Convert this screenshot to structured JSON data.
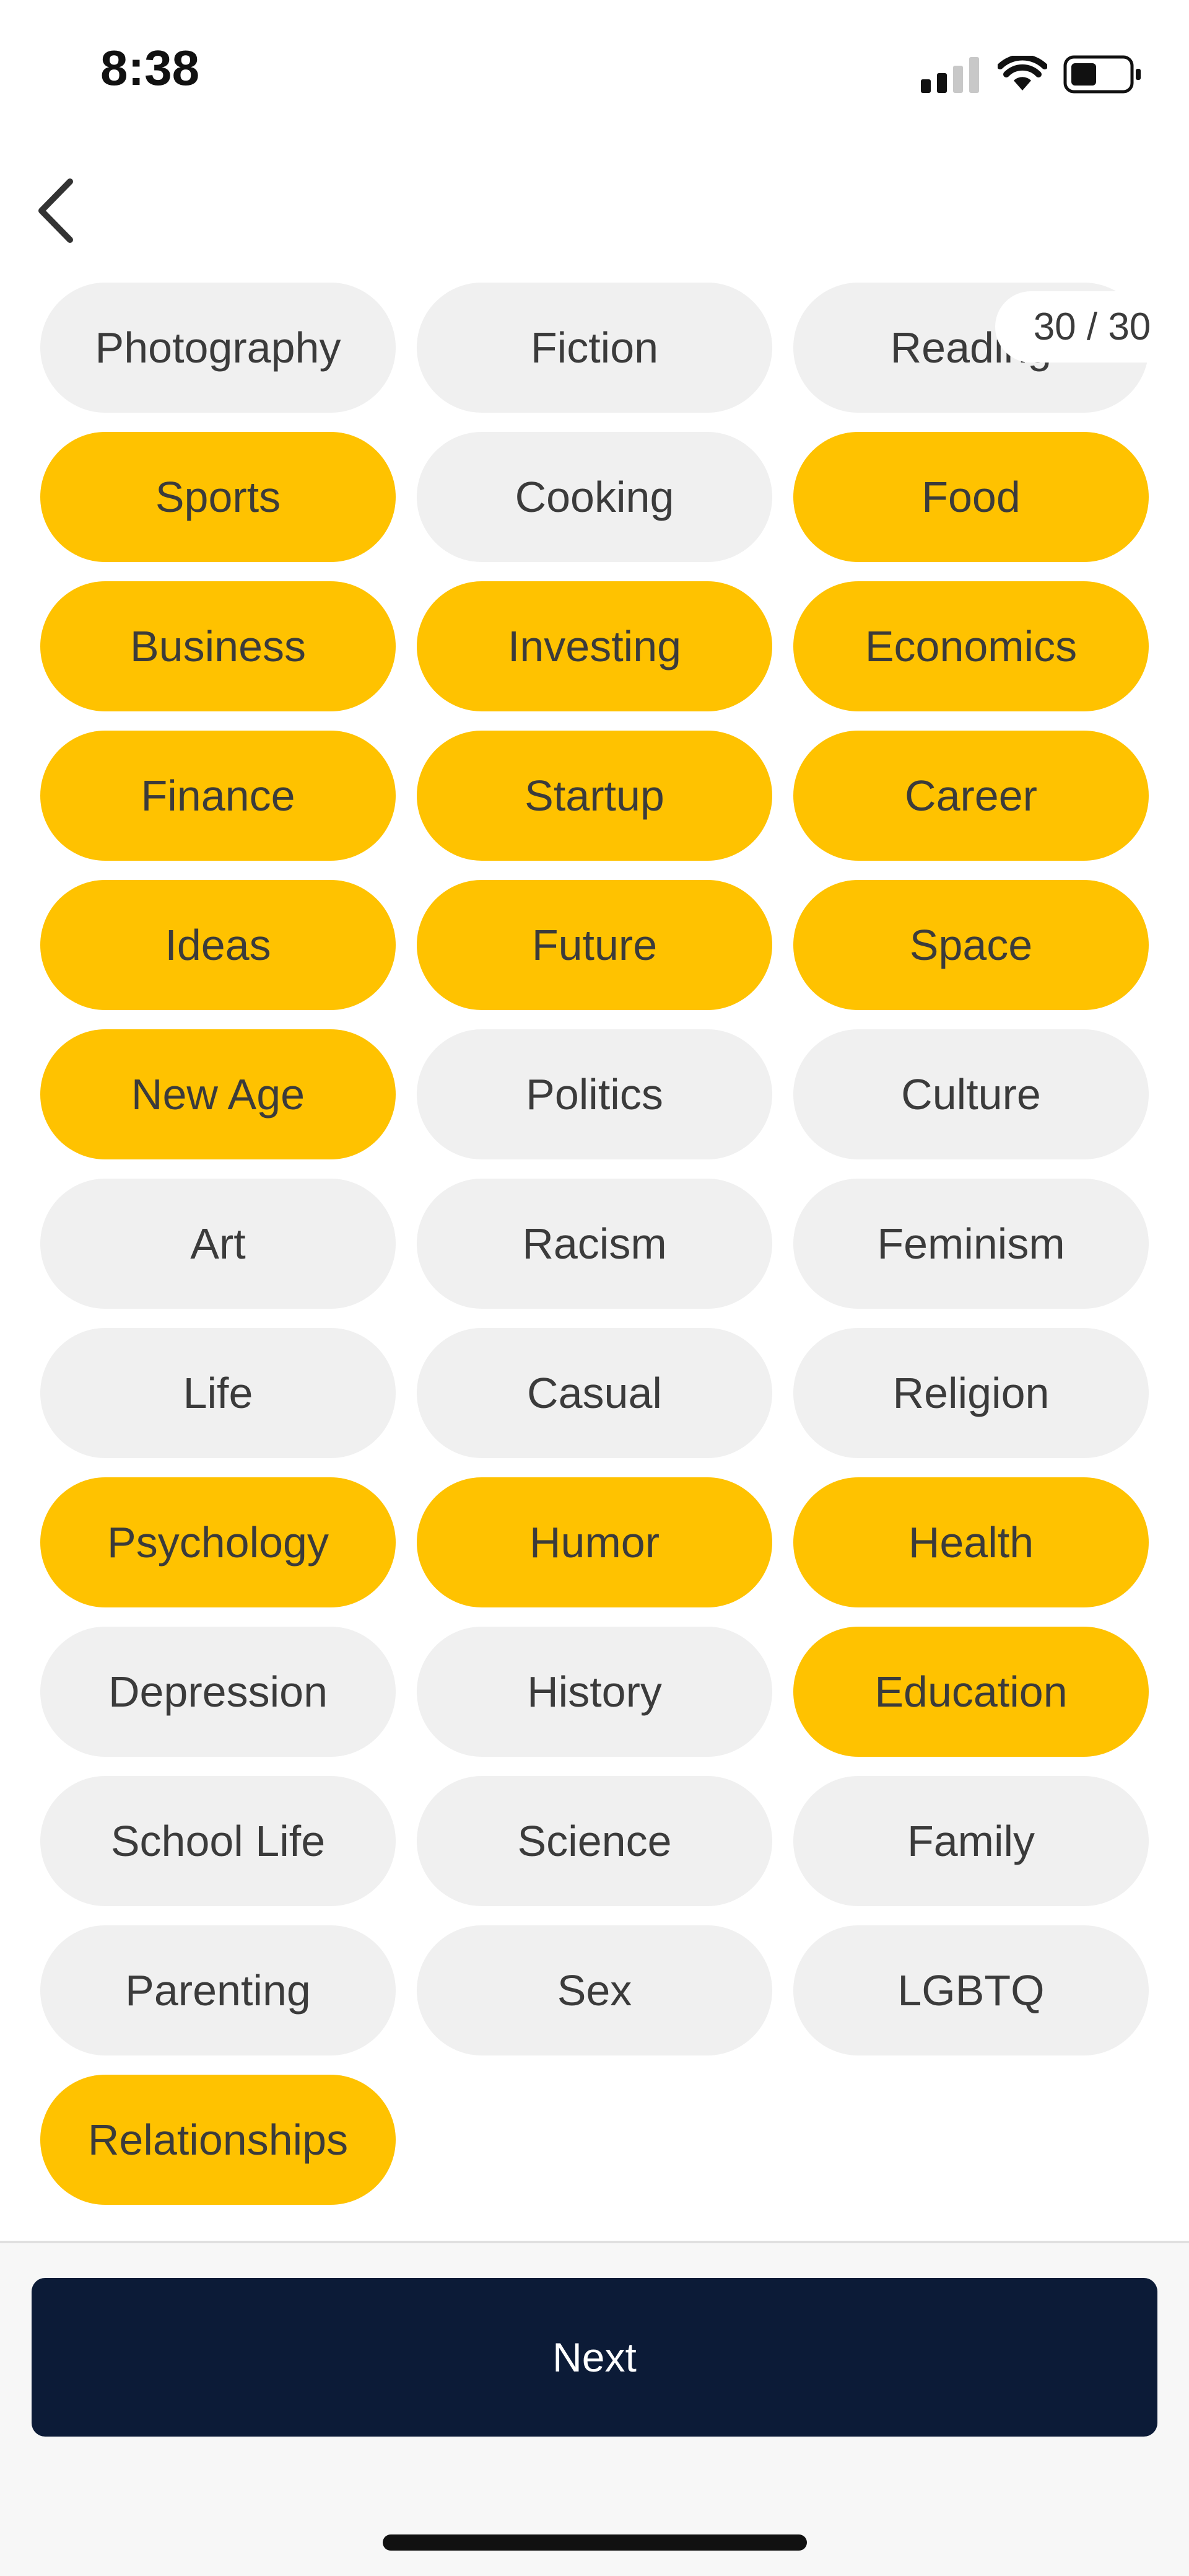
{
  "status_bar": {
    "time": "8:38"
  },
  "header": {
    "counter": "30 / 30"
  },
  "topics": [
    {
      "label": "Photography",
      "selected": false
    },
    {
      "label": "Fiction",
      "selected": false
    },
    {
      "label": "Reading",
      "selected": false
    },
    {
      "label": "Sports",
      "selected": true
    },
    {
      "label": "Cooking",
      "selected": false
    },
    {
      "label": "Food",
      "selected": true
    },
    {
      "label": "Business",
      "selected": true
    },
    {
      "label": "Investing",
      "selected": true
    },
    {
      "label": "Economics",
      "selected": true
    },
    {
      "label": "Finance",
      "selected": true
    },
    {
      "label": "Startup",
      "selected": true
    },
    {
      "label": "Career",
      "selected": true
    },
    {
      "label": "Ideas",
      "selected": true
    },
    {
      "label": "Future",
      "selected": true
    },
    {
      "label": "Space",
      "selected": true
    },
    {
      "label": "New Age",
      "selected": true
    },
    {
      "label": "Politics",
      "selected": false
    },
    {
      "label": "Culture",
      "selected": false
    },
    {
      "label": "Art",
      "selected": false
    },
    {
      "label": "Racism",
      "selected": false
    },
    {
      "label": "Feminism",
      "selected": false
    },
    {
      "label": "Life",
      "selected": false
    },
    {
      "label": "Casual",
      "selected": false
    },
    {
      "label": "Religion",
      "selected": false
    },
    {
      "label": "Psychology",
      "selected": true
    },
    {
      "label": "Humor",
      "selected": true
    },
    {
      "label": "Health",
      "selected": true
    },
    {
      "label": "Depression",
      "selected": false
    },
    {
      "label": "History",
      "selected": false
    },
    {
      "label": "Education",
      "selected": true
    },
    {
      "label": "School Life",
      "selected": false
    },
    {
      "label": "Science",
      "selected": false
    },
    {
      "label": "Family",
      "selected": false
    },
    {
      "label": "Parenting",
      "selected": false
    },
    {
      "label": "Sex",
      "selected": false
    },
    {
      "label": "LGBTQ",
      "selected": false
    },
    {
      "label": "Relationships",
      "selected": true
    }
  ],
  "footer": {
    "next_label": "Next"
  },
  "colors": {
    "selected": "#ffc200",
    "unselected": "#f0f0f0",
    "text": "#3b3b3b",
    "button": "#0c1b37"
  },
  "icons": {
    "back": "chevron-left-icon",
    "signal": "cellular-signal-icon",
    "wifi": "wifi-icon",
    "battery": "battery-icon"
  }
}
